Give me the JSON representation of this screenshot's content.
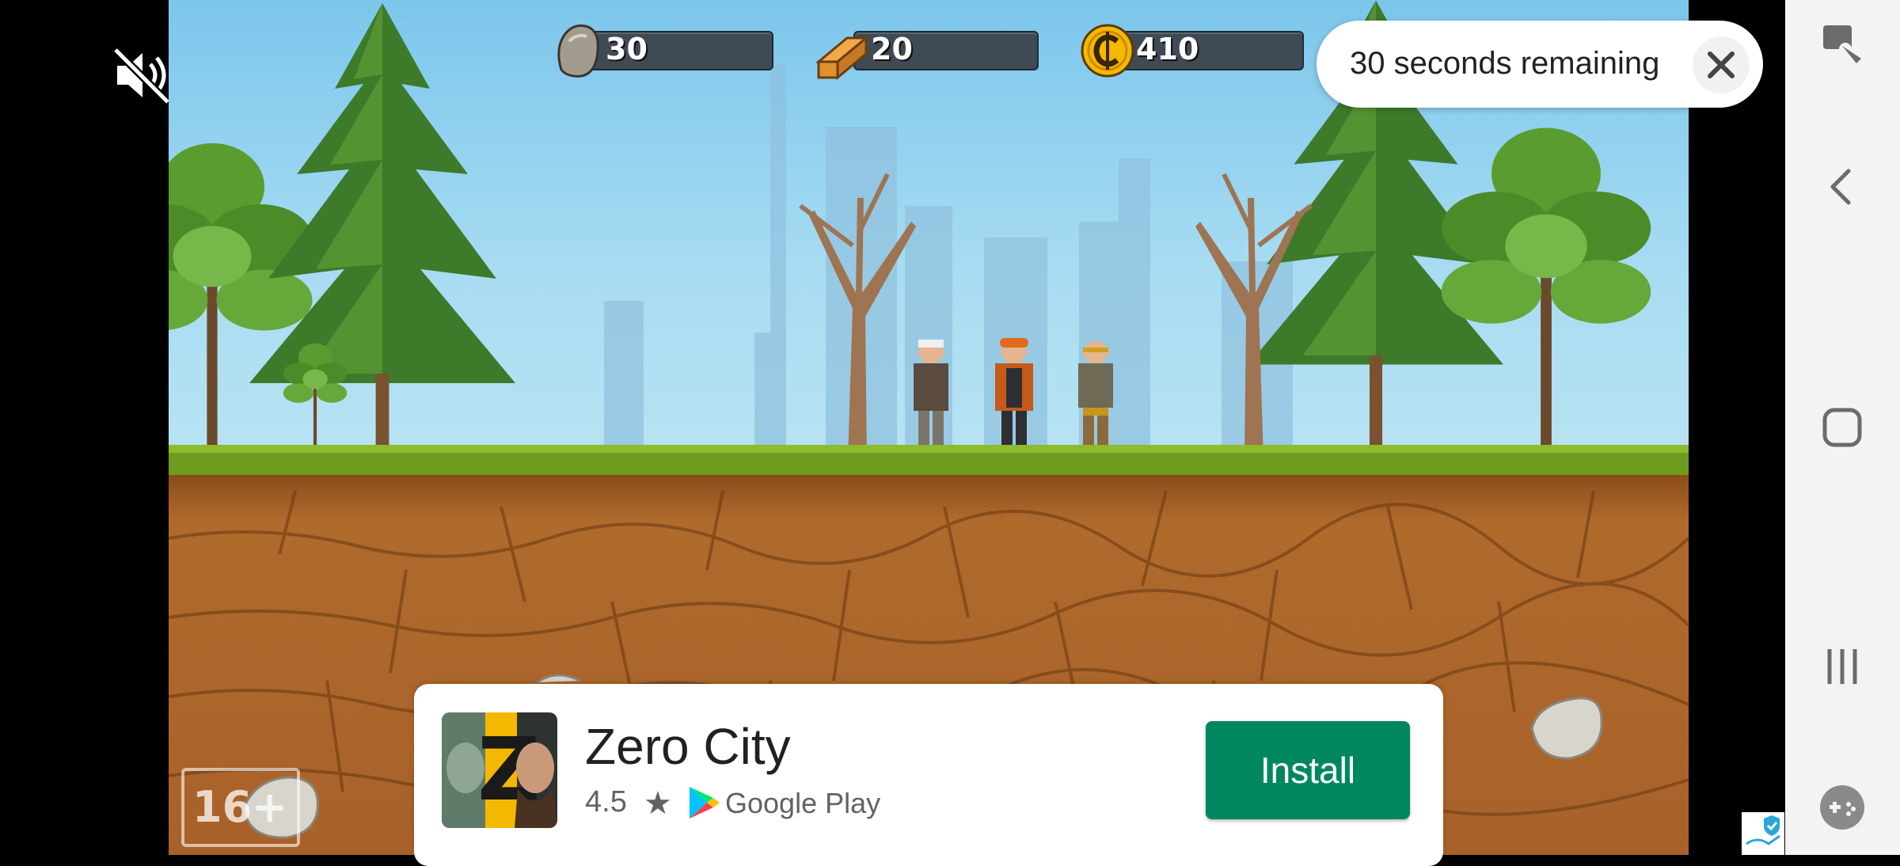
{
  "hud": {
    "stone": {
      "icon": "stone-icon",
      "value": "30"
    },
    "wood": {
      "icon": "wood-plank-icon",
      "value": "20"
    },
    "coins": {
      "icon": "coin-icon",
      "value": "410"
    }
  },
  "timer": {
    "text": "30 seconds remaining",
    "close_icon": "close-icon"
  },
  "age_rating": "16+",
  "ad": {
    "app_name": "Zero City",
    "rating": "4.5",
    "store": "Google Play",
    "install_label": "Install",
    "icon_letter": "Z"
  },
  "nav": [
    "screenshot-tool-icon",
    "back-icon",
    "home-icon",
    "recents-icon",
    "game-tools-icon"
  ],
  "colors": {
    "install": "#01875f",
    "sky": "#8fd0ef",
    "grass": "#6f9b1e",
    "dirt": "#b06a2c"
  }
}
